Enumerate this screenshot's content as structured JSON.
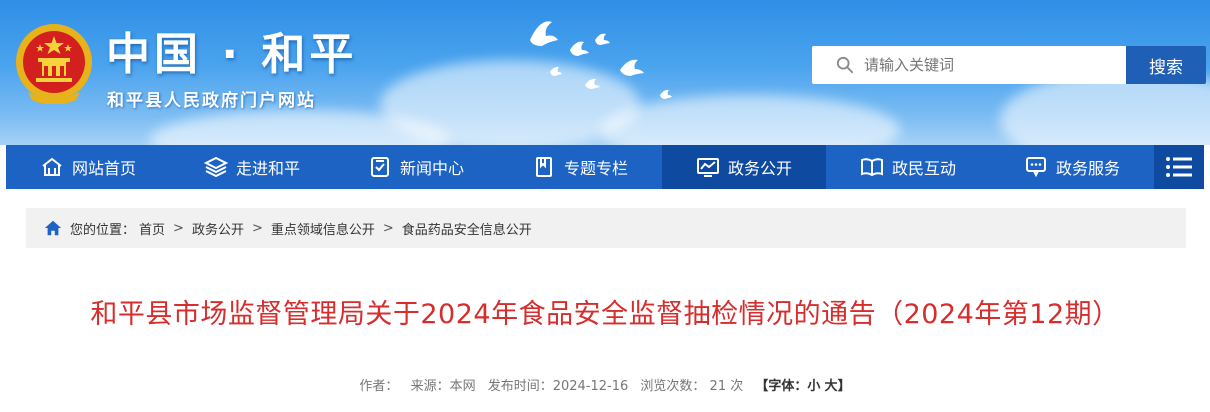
{
  "header": {
    "site_title": "中国 · 和平",
    "site_subtitle": "和平县人民政府门户网站"
  },
  "search": {
    "placeholder": "请输入关键词",
    "button_label": "搜索"
  },
  "nav": {
    "items": [
      {
        "label": "网站首页",
        "icon": "home-icon"
      },
      {
        "label": "走进和平",
        "icon": "layers-icon"
      },
      {
        "label": "新闻中心",
        "icon": "news-icon"
      },
      {
        "label": "专题专栏",
        "icon": "bookmark-icon"
      },
      {
        "label": "政务公开",
        "icon": "chart-icon",
        "active": true
      },
      {
        "label": "政民互动",
        "icon": "book-icon"
      },
      {
        "label": "政务服务",
        "icon": "service-icon"
      }
    ],
    "menu_icon": "menu-icon"
  },
  "breadcrumb": {
    "label": "您的位置：",
    "items": [
      "首页",
      "政务公开",
      "重点领域信息公开",
      "食品药品安全信息公开"
    ]
  },
  "article": {
    "title": "和平县市场监督管理局关于2024年食品安全监督抽检情况的通告（2024年第12期）",
    "author_label": "作者：",
    "source": "来源：本网",
    "publish_time": "发布时间：2024-12-16",
    "views": "浏览次数： 21 次",
    "font_label": "【字体：",
    "font_small": "小",
    "font_large": "大",
    "font_close": "】"
  },
  "colors": {
    "nav_bg": "#1c63c4",
    "nav_active": "#0d4aa0",
    "title_red": "#d62d2d",
    "search_button": "#1f5fb6"
  }
}
